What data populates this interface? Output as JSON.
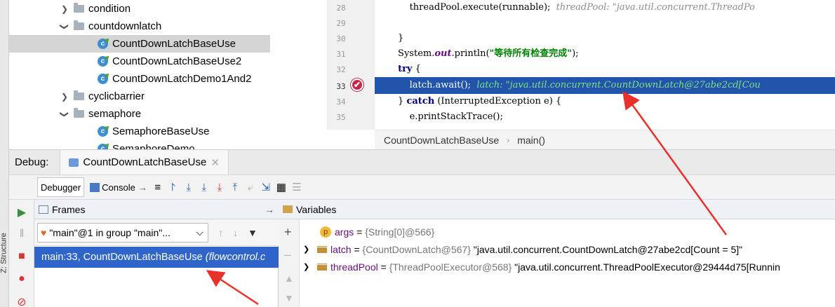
{
  "tree": {
    "items": [
      {
        "kind": "folder",
        "expanded": false,
        "label": "condition"
      },
      {
        "kind": "folder",
        "expanded": true,
        "label": "countdownlatch"
      },
      {
        "kind": "class",
        "label": "CountDownLatchBaseUse",
        "selected": true
      },
      {
        "kind": "class",
        "label": "CountDownLatchBaseUse2"
      },
      {
        "kind": "class",
        "label": "CountDownLatchDemo1And2"
      },
      {
        "kind": "folder",
        "expanded": false,
        "label": "cyclicbarrier"
      },
      {
        "kind": "folder",
        "expanded": true,
        "label": "semaphore"
      },
      {
        "kind": "class",
        "label": "SemaphoreBaseUse"
      },
      {
        "kind": "class",
        "label": "SemaphoreDemo"
      }
    ]
  },
  "editor": {
    "lines": [
      {
        "num": "28",
        "code": "            threadPool.execute(runnable);",
        "hint": "threadPool: \"java.util.concurrent.ThreadPo"
      },
      {
        "num": "29",
        "code": ""
      },
      {
        "num": "30",
        "code": "        }"
      },
      {
        "num": "31",
        "code_prefix": "        System.",
        "code_field": "out",
        "code_mid": ".println(",
        "code_str": "\"等待所有检查完成\"",
        "code_suffix": ");"
      },
      {
        "num": "32",
        "code_kw": "try",
        "code": "        try {"
      },
      {
        "num": "33",
        "code": "            latch.await();",
        "hint": "latch: \"java.util.concurrent.CountDownLatch@27abe2cd[Cou",
        "highlight": true
      },
      {
        "num": "34",
        "code": "        } catch (InterruptedException e) {"
      },
      {
        "num": "35",
        "code": "            e.printStackTrace();"
      }
    ],
    "breadcrumb": [
      "CountDownLatchBaseUse",
      "main()"
    ]
  },
  "debug": {
    "label": "Debug:",
    "tab": "CountDownLatchBaseUse",
    "toolbar": {
      "debugger": "Debugger",
      "console": "Console"
    },
    "frames_title": "Frames",
    "thread_select": "\"main\"@1 in group \"main\"...",
    "frame_row_main": "main:33, CountDownLatchBaseUse",
    "frame_row_pkg": "(flowcontrol.c",
    "variables_title": "Variables",
    "vars": [
      {
        "name": "args",
        "type": "{String[0]@566}",
        "value": ""
      },
      {
        "name": "latch",
        "type": "{CountDownLatch@567}",
        "value": "\"java.util.concurrent.CountDownLatch@27abe2cd[Count = 5]\""
      },
      {
        "name": "threadPool",
        "type": "{ThreadPoolExecutor@568}",
        "value": "\"java.util.concurrent.ThreadPoolExecutor@29444d75[Runnin"
      }
    ],
    "side_label": "Z: Structure"
  },
  "colors": {
    "selection": "#2f65ca",
    "highlight": "#2154aa",
    "arrow": "#e8312a"
  }
}
